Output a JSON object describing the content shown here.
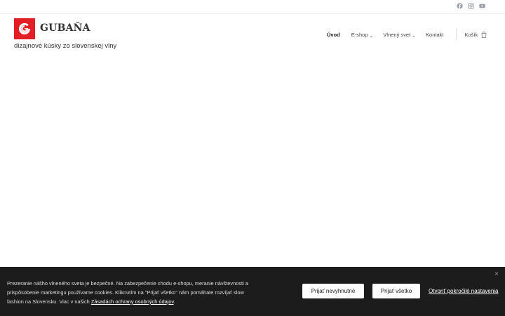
{
  "header": {
    "brand_name": "GUBAŇA",
    "tagline": "dizajnové kúsky zo slovenskej vlny",
    "social": [
      "facebook-icon",
      "instagram-icon",
      "youtube-icon"
    ],
    "brand_color": "#e31e24"
  },
  "nav": {
    "items": [
      {
        "label": "Úvod",
        "active": true,
        "has_dropdown": false
      },
      {
        "label": "E-shop",
        "active": false,
        "has_dropdown": true
      },
      {
        "label": "Vlnený svet",
        "active": false,
        "has_dropdown": true
      },
      {
        "label": "Kontakt",
        "active": false,
        "has_dropdown": false
      }
    ],
    "cart_label": "Košík"
  },
  "cookie_banner": {
    "text_before_link": "Prezeranie nášho vlneného sveta je bezpečné. Na zabezpečenie chodu e-shopu, meranie návštevnosti a prispôsobenie marketingu používame cookies. Kliknutím na \"Prijať všetko\" nám pomáhate rozvíjať slow fashion na Slovensku. Viac v našich ",
    "link_text": "Zásadách ochrany osobných údajov",
    "text_after_link": ".",
    "accept_necessary_label": "Prijať nevyhnutné",
    "accept_all_label": "Prijať všetko",
    "advanced_settings_label": "Otvoriť pokročilé nastavenia",
    "close_glyph": "×",
    "background_color": "#1c1c1c"
  }
}
